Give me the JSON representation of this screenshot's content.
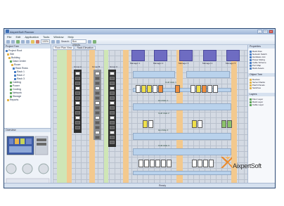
{
  "window": {
    "title": "AixpertSoft Planner",
    "buttons": [
      "_",
      "□",
      "x"
    ]
  },
  "menu": [
    "File",
    "Edit",
    "Application",
    "Tools",
    "Window",
    "Help"
  ],
  "toolbar": {
    "zoom": "100%",
    "search_label": "Search:",
    "search_value": "Box objects"
  },
  "tabs": [
    "Floor Plan View",
    "Rack Elevation"
  ],
  "tree": {
    "header": "Project Tree",
    "items": [
      "Project Root",
      "Site",
      "Building",
      "Data Center",
      "Room",
      "Rack Rows",
      "Rack 1",
      "Rack 2",
      "Rack 3",
      "Cabling",
      "Power",
      "Cooling",
      "Network",
      "Storage",
      "Reports"
    ]
  },
  "minimap": {
    "header": "Overview"
  },
  "canvas": {
    "top_labels": [
      "Manager 1",
      "Manager 2",
      "Manager 3",
      "Manager 4",
      "Manager 5"
    ],
    "rack_labels": [
      "Group A",
      "Group B",
      "Group C"
    ],
    "row_labels": [
      "Cold Aisle 1",
      "Hot Aisle 1",
      "Cold Aisle 2",
      "Hot Aisle 2",
      "Cold Aisle 3"
    ]
  },
  "right_panel": {
    "header1": "Properties",
    "items1": [
      "Rack Row",
      "Network Switch",
      "Hardware List",
      "Power Rating",
      "Cable Scheme",
      "Port Map",
      "Rack Assets"
    ],
    "header2": "Object Tree",
    "items2": [
      "Devices",
      "Server Racks",
      "Patch Panels",
      "Switches"
    ],
    "header3": "Layers",
    "items3": [
      "Floor Layer",
      "Rack Layer",
      "Cable Layer"
    ]
  },
  "status": {
    "text": "Ready"
  },
  "logo": {
    "text": "AixpertSoft"
  },
  "colors": {
    "accent": "#6e6cc2",
    "yellow": "#efe04b",
    "orange": "#f08d3c",
    "green": "#8cc26c"
  }
}
